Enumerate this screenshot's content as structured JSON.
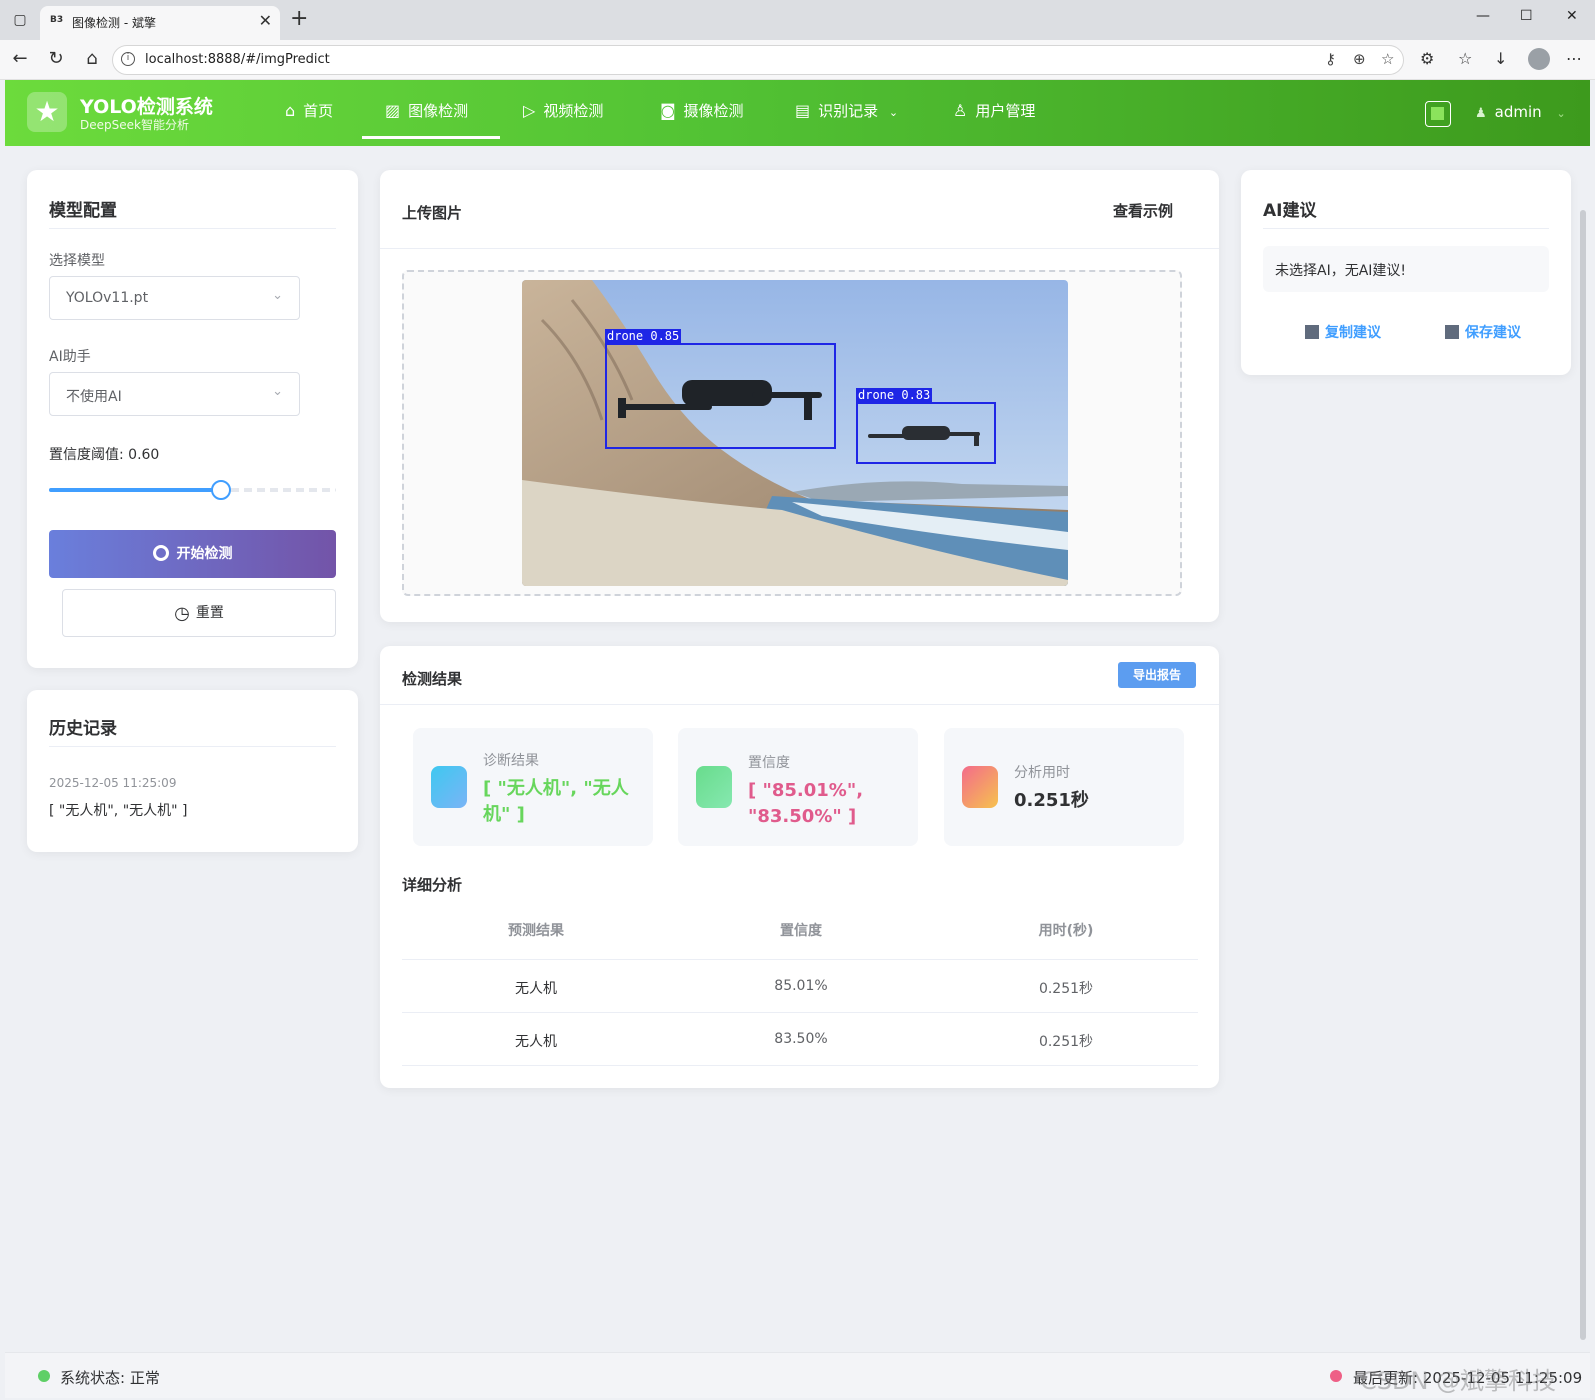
{
  "browser": {
    "tab_favicon": "B3",
    "tab_title": "图像检测 - 斌擎",
    "url": "localhost:8888/#/imgPredict"
  },
  "header": {
    "brand": "YOLO检测系统",
    "brand_sub": "DeepSeek智能分析",
    "nav": [
      {
        "label": "首页",
        "icon": "home-icon"
      },
      {
        "label": "图像检测",
        "icon": "image-icon"
      },
      {
        "label": "视频检测",
        "icon": "play-icon"
      },
      {
        "label": "摄像检测",
        "icon": "camera-icon"
      },
      {
        "label": "识别记录",
        "icon": "document-icon"
      },
      {
        "label": "用户管理",
        "icon": "user-icon"
      }
    ],
    "username": "admin"
  },
  "config": {
    "title": "模型配置",
    "model_label": "选择模型",
    "model_value": "YOLOv11.pt",
    "ai_label": "AI助手",
    "ai_value": "不使用AI",
    "threshold_label": "置信度阈值: 0.60",
    "threshold_value": 0.6,
    "start_button": "开始检测",
    "reset_button": "重置"
  },
  "history": {
    "title": "历史记录",
    "items": [
      {
        "time": "2025-12-05 11:25:09",
        "result": "[ \"无人机\", \"无人机\" ]"
      }
    ]
  },
  "upload": {
    "title": "上传图片",
    "example_link": "查看示例",
    "detections": [
      {
        "label": "drone 0.85"
      },
      {
        "label": "drone 0.83"
      }
    ]
  },
  "results": {
    "title": "检测结果",
    "export_button": "导出报告",
    "stats": [
      {
        "label": "诊断结果",
        "value": "[ \"无人机\", \"无人\n机\" ]",
        "color": "#67d65c"
      },
      {
        "label": "置信度",
        "value": "[ \"85.01%\",\n\"83.50%\" ]",
        "color": "#e05b8c"
      },
      {
        "label": "分析用时",
        "value": "0.251秒",
        "color": "#303133"
      }
    ],
    "detail_title": "详细分析",
    "table": {
      "headers": [
        "预测结果",
        "置信度",
        "用时(秒)"
      ],
      "rows": [
        [
          "无人机",
          "85.01%",
          "0.251秒"
        ],
        [
          "无人机",
          "83.50%",
          "0.251秒"
        ]
      ]
    }
  },
  "ai_advice": {
    "title": "AI建议",
    "message": "未选择AI，无AI建议!",
    "copy_button": "复制建议",
    "save_button": "保存建议"
  },
  "footer": {
    "status": "系统状态: 正常",
    "last_update": "最后更新: 2025-12-05 11:25:09",
    "watermark": "CSDN @斌擎科技"
  }
}
